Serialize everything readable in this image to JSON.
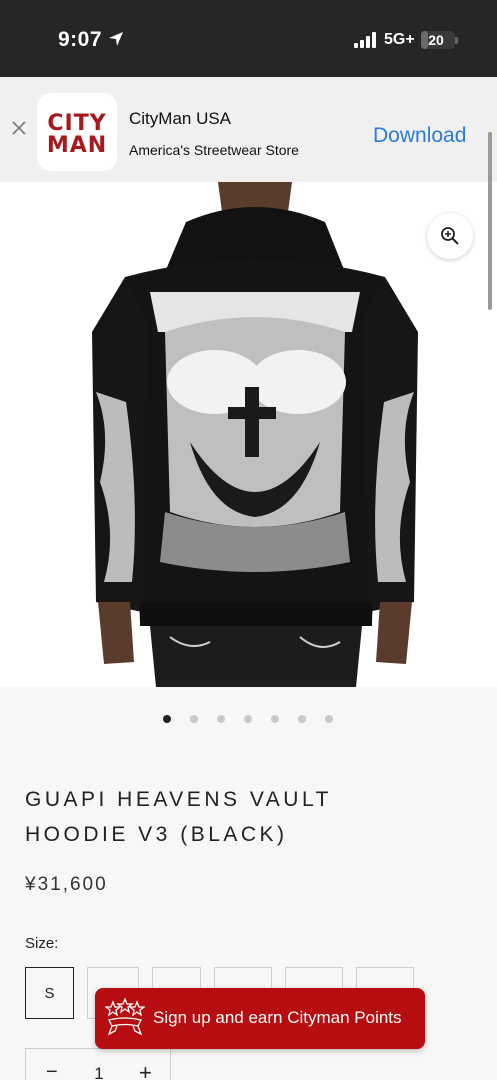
{
  "status_bar": {
    "time": "9:07",
    "network": "5G+",
    "battery": "20",
    "battery_level": 0.2,
    "icons": [
      "location-arrow-icon",
      "cellular-signal-icon",
      "battery-icon"
    ]
  },
  "app_banner": {
    "icon_line1": "CITY",
    "icon_line2": "MAN",
    "app_name": "CityMan USA",
    "tagline": "America's Streetwear Store",
    "download_label": "Download",
    "colors": {
      "brand": "#a8181d",
      "link": "#2e7ad8"
    }
  },
  "gallery": {
    "image_count": 7,
    "active_index": 0,
    "icons": [
      "zoom-in-icon"
    ]
  },
  "product": {
    "title": "GUAPI HEAVENS VAULT HOODIE V3 (BLACK)",
    "price": "¥31,600"
  },
  "size": {
    "label": "Size:",
    "selected": "S",
    "options": [
      "S",
      "",
      "",
      "",
      "",
      ""
    ]
  },
  "quantity": {
    "minus": "−",
    "value": "1",
    "plus": "+"
  },
  "rewards": {
    "label": "Sign up and earn Cityman Points",
    "color": "#b50d10",
    "icon": "rewards-stars-icon"
  }
}
